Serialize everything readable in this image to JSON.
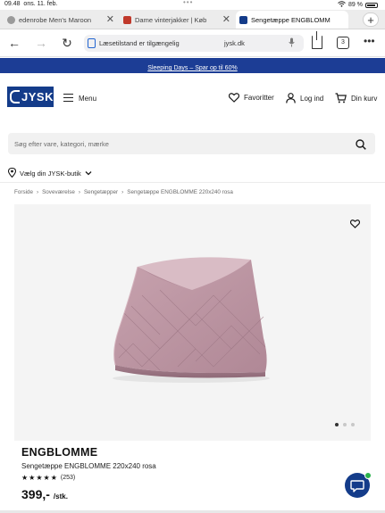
{
  "status_bar": {
    "time": "09.48",
    "date": "ons. 11. feb.",
    "center": "•••",
    "battery": "89 %"
  },
  "tabs": [
    {
      "title": "edenrobe Men's Maroon",
      "active": false,
      "icon_color": "#9a9a9a"
    },
    {
      "title": "Dame vinterjakker | Køb",
      "active": false,
      "icon_color": "#c0392b"
    },
    {
      "title": "Sengetæppe ENGBLOMM",
      "active": true,
      "icon_color": "#143c8a"
    }
  ],
  "new_tab": "+",
  "toolbar": {
    "reader_label": "Læsetilstand er tilgængelig",
    "url": "jysk.dk",
    "tab_count": "3",
    "more": "•••"
  },
  "promo": {
    "text": "Sleeping Days – Spar op til 60%"
  },
  "header": {
    "logo": "JYSK",
    "menu_label": "Menu",
    "favorites_label": "Favoritter",
    "login_label": "Log ind",
    "cart_label": "Din kurv"
  },
  "search": {
    "placeholder": "Søg efter vare, kategori, mærke"
  },
  "store_selector": {
    "label": "Vælg din JYSK-butik"
  },
  "breadcrumb": {
    "items": [
      "Forside",
      "Soveværelse",
      "Sengetæpper",
      "Sengetæppe ENGBLOMME 220x240 rosa"
    ],
    "separator": "›"
  },
  "gallery": {
    "slides": 3,
    "active_slide": 1
  },
  "product": {
    "brand": "ENGBLOMME",
    "name": "Sengetæppe ENGBLOMME 220x240 rosa",
    "rating": 5,
    "review_count": "(253)",
    "price": "399,-",
    "unit": "/stk."
  },
  "colors": {
    "brand_blue": "#143c8a",
    "promo_blue": "#1c3d95",
    "chat_badge": "#2bb24c",
    "product_pink": "#b8929e"
  }
}
